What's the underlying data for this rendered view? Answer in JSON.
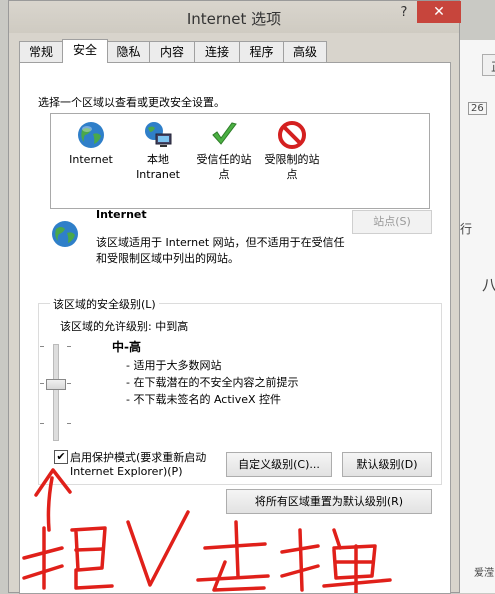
{
  "window": {
    "title": "Internet 选项",
    "help": "?",
    "close": "✕"
  },
  "tabs": [
    "常规",
    "安全",
    "隐私",
    "内容",
    "连接",
    "程序",
    "高级"
  ],
  "zones_prompt": "选择一个区域以查看或更改安全设置。",
  "zones": [
    {
      "label1": "Internet",
      "label2": ""
    },
    {
      "label1": "本地",
      "label2": "Intranet"
    },
    {
      "label1": "受信任的站",
      "label2": "点"
    },
    {
      "label1": "受限制的站",
      "label2": "点"
    }
  ],
  "selected_zone": {
    "name": "Internet",
    "desc1": "该区域适用于 Internet 网站，但不适用于在受信任",
    "desc2": "和受限制区域中列出的网站。",
    "sites_button": "站点(S)"
  },
  "security_level": {
    "group_label": "该区域的安全级别(L)",
    "allowed": "该区域的允许级别: 中到高",
    "level": "中-高",
    "bullets": [
      "- 适用于大多数网站",
      "- 在下载潜在的不安全内容之前提示",
      "- 不下载未签名的 ActiveX 控件"
    ],
    "protected_mode_line1": "启用保护模式(要求重新启动",
    "protected_mode_line2": "Internet Explorer)(P)",
    "protected_mode_checked": true,
    "custom_button": "自定义级别(C)...",
    "default_button": "默认级别(D)",
    "reset_button": "将所有区域重置为默认级别(R)"
  },
  "annotation": {
    "text": "把√去掉",
    "color": "#e0201a"
  },
  "background_window": {
    "btn_label": "正",
    "num": "26",
    "item1": "行",
    "item2": "八",
    "item3": "爱滢"
  }
}
